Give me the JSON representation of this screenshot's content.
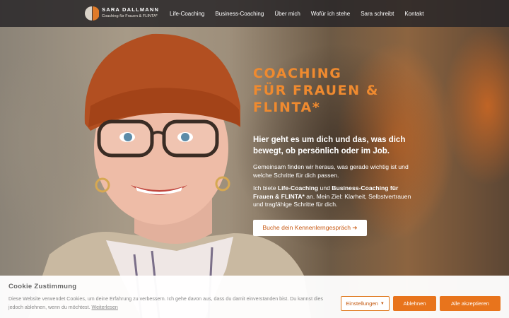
{
  "brand": {
    "name": "SARA DALLMANN",
    "tagline": "Coaching für Frauen & FLINTA*"
  },
  "nav": {
    "items": [
      "Life-Coaching",
      "Business-Coaching",
      "Über mich",
      "Wofür ich stehe",
      "Sara schreibt",
      "Kontakt"
    ]
  },
  "hero": {
    "headline_line1": "COACHING",
    "headline_line2": "FÜR FRAUEN &",
    "headline_line3": "FLINTA*",
    "subhead": "Hier geht es um dich und das, was dich bewegt, ob persönlich oder im Job.",
    "para1": "Gemeinsam finden wir heraus, was gerade wichtig ist und welche Schritte für dich passen.",
    "para2_pre": "Ich biete ",
    "para2_b1": "Life-Coaching",
    "para2_mid1": " und ",
    "para2_b2": "Business-Coaching für Frauen & FLINTA*",
    "para2_post": " an. Mein Ziel: Klarheit, Selbstvertrauen und tragfähige Schritte für dich.",
    "cta_label": "Buche dein Kennenlerngespräch ➔"
  },
  "cookie": {
    "title": "Cookie Zustimmung",
    "text": "Diese Website verwendet Cookies, um deine Erfahrung zu verbessern. Ich gehe davon aus, dass du damit einverstanden bist. Du kannst dies jedoch ablehnen, wenn du möchtest.",
    "link": "Weiterlesen",
    "settings_label": "Einstellungen",
    "decline_label": "Ablehnen",
    "accept_label": "Alle akzeptieren"
  },
  "colors": {
    "accent": "#ef8a2f",
    "button": "#e8741c",
    "nav_bg": "#282628"
  },
  "icons": {
    "logo": "half-circle-logo-icon",
    "cta_arrow": "arrow-right-icon",
    "settings_caret": "caret-down-icon"
  }
}
